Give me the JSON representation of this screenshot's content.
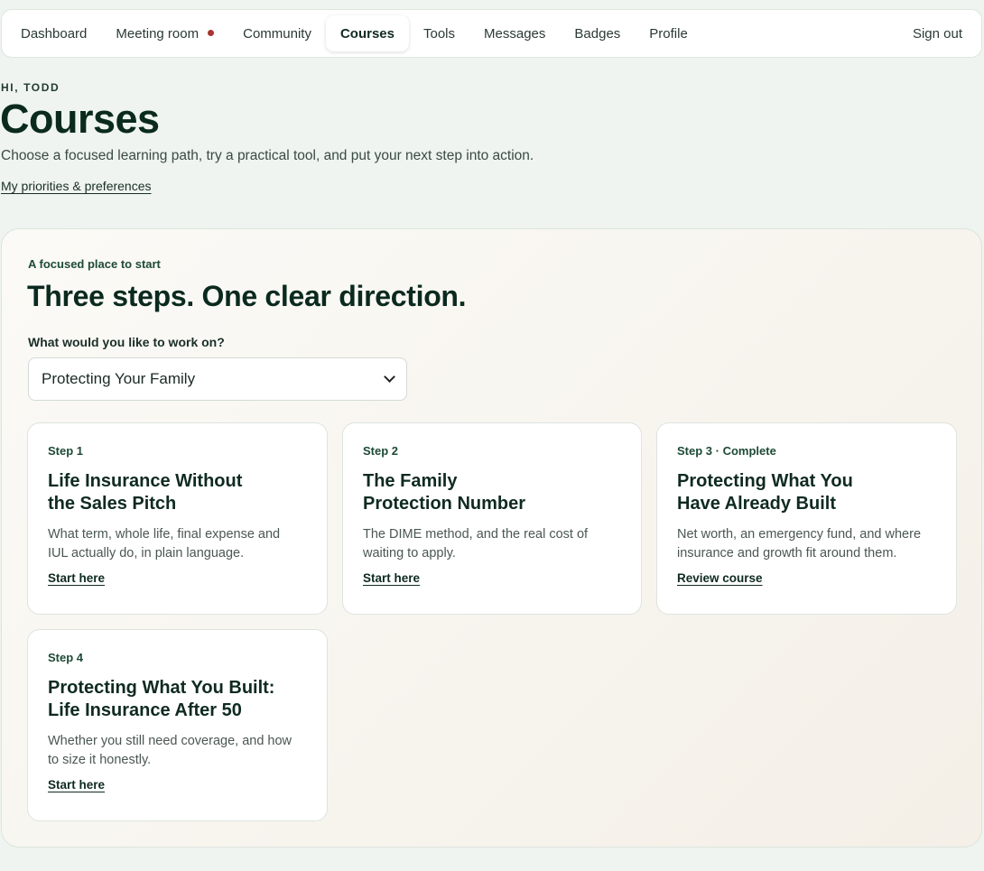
{
  "nav": {
    "items": [
      {
        "label": "Dashboard",
        "active": false
      },
      {
        "label": "Meeting room",
        "active": false,
        "notification": true
      },
      {
        "label": "Community",
        "active": false
      },
      {
        "label": "Courses",
        "active": true
      },
      {
        "label": "Tools",
        "active": false
      },
      {
        "label": "Messages",
        "active": false
      },
      {
        "label": "Badges",
        "active": false
      },
      {
        "label": "Profile",
        "active": false
      }
    ],
    "sign_out": "Sign out"
  },
  "header": {
    "greeting": "HI, TODD",
    "title": "Courses",
    "subtitle": "Choose a focused learning path, try a practical tool, and put your next step into action.",
    "preferences_link": "My priorities & preferences"
  },
  "panel": {
    "eyebrow": "A focused place to start",
    "title": "Three steps. One clear direction.",
    "select_label": "What would you like to work on?",
    "selected_option": "Protecting Your Family",
    "cards": [
      {
        "step": "Step 1",
        "title_line1": "Life Insurance Without",
        "title_line2": "the Sales Pitch",
        "desc_line1": "What term, whole life, final expense and",
        "desc_line2": "IUL actually do, in plain language.",
        "link": "Start here"
      },
      {
        "step": "Step 2",
        "title_line1": "The Family",
        "title_line2": "Protection Number",
        "desc_line1": "The DIME method, and the real cost of",
        "desc_line2": "waiting to apply.",
        "link": "Start here"
      },
      {
        "step": "Step 3 · Complete",
        "title_line1": "Protecting What You",
        "title_line2": "Have Already Built",
        "desc_line1": "Net worth, an emergency fund, and where",
        "desc_line2": "insurance and growth fit around them.",
        "link": "Review course"
      },
      {
        "step": "Step 4",
        "title_line1": "Protecting What You Built:",
        "title_line2": "Life Insurance After 50",
        "desc_line1": "Whether you still need coverage, and how",
        "desc_line2": "to size it honestly.",
        "link": "Start here"
      }
    ]
  },
  "colors": {
    "background": "#eff4f0",
    "heading": "#0b2a1f",
    "accent_green": "#1d4a36",
    "notification_dot": "#a8352f"
  }
}
